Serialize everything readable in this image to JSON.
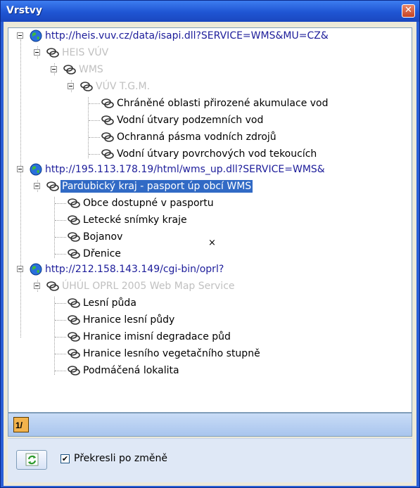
{
  "window": {
    "title": "Vrstvy",
    "close_glyph": "✕"
  },
  "tree": {
    "nodes": [
      {
        "label": "http://heis.vuv.cz/data/isapi.dll?SERVICE=WMS&MU=CZ&",
        "icon": "globe-icon",
        "style": "url"
      },
      {
        "label": "HEIS VÚV",
        "icon": "layers-icon",
        "style": "grey"
      },
      {
        "label": "WMS",
        "icon": "layers-icon",
        "style": "grey"
      },
      {
        "label": "VÚV T.G.M.",
        "icon": "layers-icon",
        "style": "grey"
      },
      {
        "label": "Chráněné oblasti přirozené akumulace vod",
        "icon": "layers-icon",
        "style": "black"
      },
      {
        "label": "Vodní útvary podzemních vod",
        "icon": "layers-icon",
        "style": "black"
      },
      {
        "label": "Ochranná pásma vodních zdrojů",
        "icon": "layers-icon",
        "style": "black"
      },
      {
        "label": "Vodní útvary povrchových vod tekoucích",
        "icon": "layers-icon",
        "style": "black"
      },
      {
        "label": "http://195.113.178.19/html/wms_up.dll?SERVICE=WMS&",
        "icon": "globe-icon",
        "style": "url"
      },
      {
        "label": "Pardubický kraj - pasport úp obcí WMS",
        "icon": "layers-icon",
        "style": "sel"
      },
      {
        "label": "Obce dostupné v pasportu",
        "icon": "layers-icon",
        "style": "black"
      },
      {
        "label": "Letecké snímky kraje",
        "icon": "layers-icon",
        "style": "black"
      },
      {
        "label": "Bojanov",
        "icon": "layers-icon",
        "style": "black"
      },
      {
        "label": "Dřenice",
        "icon": "layers-icon",
        "style": "black"
      },
      {
        "label": "http://212.158.143.149/cgi-bin/oprl?",
        "icon": "globe-icon",
        "style": "url"
      },
      {
        "label": "ÚHÚL OPRL 2005 Web Map Service",
        "icon": "layers-icon",
        "style": "grey"
      },
      {
        "label": "Lesní půda",
        "icon": "layers-icon",
        "style": "black"
      },
      {
        "label": "Hranice lesní půdy",
        "icon": "layers-icon",
        "style": "black"
      },
      {
        "label": "Hranice imisní degradace půd",
        "icon": "layers-icon",
        "style": "black"
      },
      {
        "label": "Hranice lesního vegetačního stupně",
        "icon": "layers-icon",
        "style": "black"
      },
      {
        "label": "Podmáčená lokalita",
        "icon": "layers-icon",
        "style": "black"
      }
    ]
  },
  "toolbar": {
    "tool_icon": "layer-properties-icon",
    "tool_text": "1/"
  },
  "bottom": {
    "refresh_icon": "refresh-icon",
    "redraw_checked": true,
    "redraw_label": "Překresli po změně",
    "check_glyph": "✔"
  },
  "cursor_glyph": "×"
}
